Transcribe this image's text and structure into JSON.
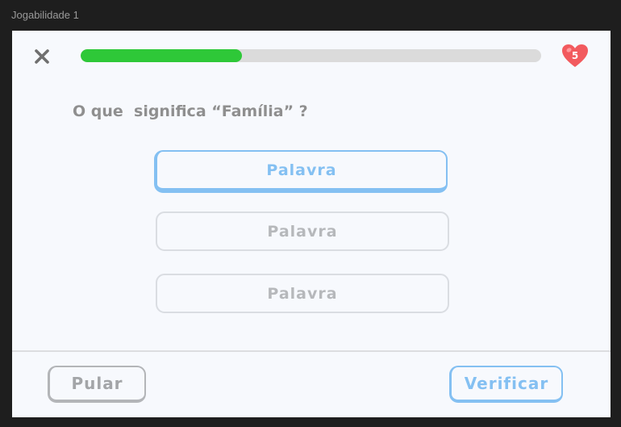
{
  "frame": {
    "title": "Jogabilidade 1"
  },
  "header": {
    "close_icon": "close-icon",
    "progress_fraction": 0.35,
    "progress_color": "#2ec838",
    "lives": "5",
    "heart_color": "#f25a5e"
  },
  "question": {
    "text": "O que  significa “Família” ?"
  },
  "options": [
    {
      "label": "Palavra",
      "selected": true
    },
    {
      "label": "Palavra",
      "selected": false
    },
    {
      "label": "Palavra",
      "selected": false
    }
  ],
  "footer": {
    "skip_label": "Pular",
    "check_label": "Verificar"
  },
  "colors": {
    "accent_blue": "#84c0f2",
    "text_gray": "#8f8f8f",
    "background": "#f7f9fd"
  }
}
